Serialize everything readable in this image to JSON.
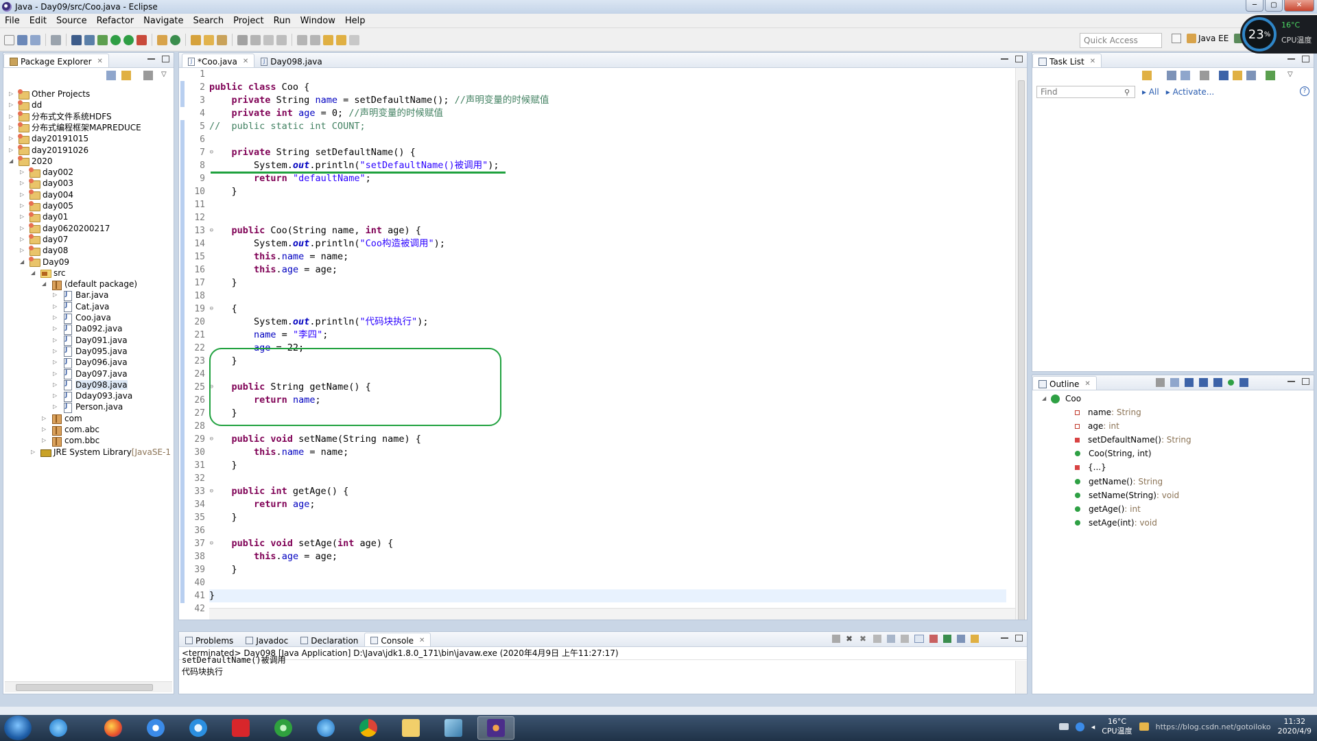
{
  "window": {
    "title": "Java - Day09/src/Coo.java - Eclipse",
    "buttons": [
      "─",
      "▢",
      "✕"
    ]
  },
  "menu": [
    "File",
    "Edit",
    "Source",
    "Refactor",
    "Navigate",
    "Search",
    "Project",
    "Run",
    "Window",
    "Help"
  ],
  "toolbar": {
    "quick_access_placeholder": "Quick Access",
    "perspective": "Java EE"
  },
  "cpu_widget": {
    "percent": "23",
    "percent_sign": "%",
    "temp": "16°C",
    "label": "CPU温度"
  },
  "package_explorer": {
    "title": "Package Explorer",
    "items": [
      {
        "label": "Other Projects",
        "icon": "project-icon",
        "depth": 0,
        "expand": "▷"
      },
      {
        "label": "dd",
        "icon": "project-icon",
        "depth": 0,
        "expand": "▷"
      },
      {
        "label": "分布式文件系统HDFS",
        "icon": "project-icon",
        "depth": 0,
        "expand": "▷"
      },
      {
        "label": "分布式编程框架MAPREDUCE",
        "icon": "project-icon",
        "depth": 0,
        "expand": "▷"
      },
      {
        "label": "day20191015",
        "icon": "project-icon",
        "depth": 0,
        "expand": "▷"
      },
      {
        "label": "day20191026",
        "icon": "project-icon",
        "depth": 0,
        "expand": "▷"
      },
      {
        "label": "2020",
        "icon": "project-icon",
        "depth": 0,
        "expand": "◢"
      },
      {
        "label": "day002",
        "icon": "project-icon",
        "depth": 1,
        "expand": "▷"
      },
      {
        "label": "day003",
        "icon": "project-icon",
        "depth": 1,
        "expand": "▷"
      },
      {
        "label": "day004",
        "icon": "project-icon",
        "depth": 1,
        "expand": "▷"
      },
      {
        "label": "day005",
        "icon": "project-icon",
        "depth": 1,
        "expand": "▷"
      },
      {
        "label": "day01",
        "icon": "project-icon",
        "depth": 1,
        "expand": "▷"
      },
      {
        "label": "day0620200217",
        "icon": "project-icon",
        "depth": 1,
        "expand": "▷"
      },
      {
        "label": "day07",
        "icon": "project-icon",
        "depth": 1,
        "expand": "▷"
      },
      {
        "label": "day08",
        "icon": "project-icon",
        "depth": 1,
        "expand": "▷"
      },
      {
        "label": "Day09",
        "icon": "project-icon",
        "depth": 1,
        "expand": "◢"
      },
      {
        "label": "src",
        "icon": "source-folder-icon",
        "depth": 2,
        "expand": "◢"
      },
      {
        "label": "(default package)",
        "icon": "package-icon",
        "depth": 3,
        "expand": "◢"
      },
      {
        "label": "Bar.java",
        "icon": "java-file-icon",
        "depth": 4,
        "expand": "▷"
      },
      {
        "label": "Cat.java",
        "icon": "java-file-icon",
        "depth": 4,
        "expand": "▷"
      },
      {
        "label": "Coo.java",
        "icon": "java-file-icon",
        "depth": 4,
        "expand": "▷"
      },
      {
        "label": "Da092.java",
        "icon": "java-file-icon",
        "depth": 4,
        "expand": "▷"
      },
      {
        "label": "Day091.java",
        "icon": "java-file-icon",
        "depth": 4,
        "expand": "▷"
      },
      {
        "label": "Day095.java",
        "icon": "java-file-icon",
        "depth": 4,
        "expand": "▷"
      },
      {
        "label": "Day096.java",
        "icon": "java-file-icon",
        "depth": 4,
        "expand": "▷"
      },
      {
        "label": "Day097.java",
        "icon": "java-file-icon",
        "depth": 4,
        "expand": "▷"
      },
      {
        "label": "Day098.java",
        "icon": "java-file-icon",
        "depth": 4,
        "expand": "▷",
        "selected": true
      },
      {
        "label": "Dday093.java",
        "icon": "java-file-icon",
        "depth": 4,
        "expand": "▷"
      },
      {
        "label": "Person.java",
        "icon": "java-file-icon",
        "depth": 4,
        "expand": "▷"
      },
      {
        "label": "com",
        "icon": "package-icon",
        "depth": 3,
        "expand": "▷"
      },
      {
        "label": "com.abc",
        "icon": "package-icon",
        "depth": 3,
        "expand": "▷"
      },
      {
        "label": "com.bbc",
        "icon": "package-icon",
        "depth": 3,
        "expand": "▷"
      },
      {
        "label": "JRE System Library",
        "suffix": " [JavaSE-1",
        "icon": "library-icon",
        "depth": 2,
        "expand": "▷"
      }
    ]
  },
  "editor": {
    "tabs": [
      {
        "label": "*Coo.java",
        "active": true
      },
      {
        "label": "Day098.java",
        "active": false
      }
    ],
    "lines": [
      {
        "n": "1",
        "tokens": []
      },
      {
        "n": "2",
        "tokens": [
          [
            "kw",
            "public class "
          ],
          [
            "",
            "Coo {"
          ]
        ]
      },
      {
        "n": "3",
        "tokens": [
          [
            "",
            "    "
          ],
          [
            "kw",
            "private "
          ],
          [
            "",
            "String "
          ],
          [
            "fld",
            "name"
          ],
          [
            "",
            " = setDefaultName(); "
          ],
          [
            "cmt",
            "//声明变量的时候赋值"
          ]
        ]
      },
      {
        "n": "4",
        "tokens": [
          [
            "",
            "    "
          ],
          [
            "kw",
            "private int "
          ],
          [
            "fld",
            "age"
          ],
          [
            "",
            " = 0; "
          ],
          [
            "cmt",
            "//声明变量的时候赋值"
          ]
        ]
      },
      {
        "n": "5",
        "tokens": [
          [
            "cmt",
            "//  public static int COUNT;"
          ]
        ]
      },
      {
        "n": "6",
        "tokens": []
      },
      {
        "n": "7",
        "fold": true,
        "tokens": [
          [
            "",
            "    "
          ],
          [
            "kw",
            "private "
          ],
          [
            "",
            "String setDefaultName() {"
          ]
        ]
      },
      {
        "n": "8",
        "tokens": [
          [
            "",
            "        System."
          ],
          [
            "sta",
            "out"
          ],
          [
            "",
            ".println("
          ],
          [
            "str",
            "\"setDefaultName()被调用\""
          ],
          [
            "",
            ");"
          ]
        ]
      },
      {
        "n": "9",
        "tokens": [
          [
            "",
            "        "
          ],
          [
            "kw",
            "return "
          ],
          [
            "str",
            "\"defaultName\""
          ],
          [
            "",
            ";"
          ]
        ]
      },
      {
        "n": "10",
        "tokens": [
          [
            "",
            "    }"
          ]
        ]
      },
      {
        "n": "11",
        "tokens": []
      },
      {
        "n": "12",
        "tokens": []
      },
      {
        "n": "13",
        "fold": true,
        "tokens": [
          [
            "",
            "    "
          ],
          [
            "kw",
            "public "
          ],
          [
            "",
            "Coo(String name, "
          ],
          [
            "kw",
            "int "
          ],
          [
            "",
            "age) {"
          ]
        ]
      },
      {
        "n": "14",
        "tokens": [
          [
            "",
            "        System."
          ],
          [
            "sta",
            "out"
          ],
          [
            "",
            ".println("
          ],
          [
            "str",
            "\"Coo构造被调用\""
          ],
          [
            "",
            ");"
          ]
        ]
      },
      {
        "n": "15",
        "tokens": [
          [
            "",
            "        "
          ],
          [
            "kw",
            "this"
          ],
          [
            "",
            "."
          ],
          [
            "fld",
            "name"
          ],
          [
            "",
            " = name;"
          ]
        ]
      },
      {
        "n": "16",
        "tokens": [
          [
            "",
            "        "
          ],
          [
            "kw",
            "this"
          ],
          [
            "",
            "."
          ],
          [
            "fld",
            "age"
          ],
          [
            "",
            " = age;"
          ]
        ]
      },
      {
        "n": "17",
        "tokens": [
          [
            "",
            "    }"
          ]
        ]
      },
      {
        "n": "18",
        "tokens": []
      },
      {
        "n": "19",
        "fold": true,
        "tokens": [
          [
            "",
            "    {"
          ]
        ]
      },
      {
        "n": "20",
        "tokens": [
          [
            "",
            "        System."
          ],
          [
            "sta",
            "out"
          ],
          [
            "",
            ".println("
          ],
          [
            "str",
            "\"代码块执行\""
          ],
          [
            "",
            ");"
          ]
        ]
      },
      {
        "n": "21",
        "tokens": [
          [
            "",
            "        "
          ],
          [
            "fld",
            "name"
          ],
          [
            "",
            " = "
          ],
          [
            "str",
            "\"李四\""
          ],
          [
            "",
            ";"
          ]
        ]
      },
      {
        "n": "22",
        "tokens": [
          [
            "",
            "        "
          ],
          [
            "fld",
            "age"
          ],
          [
            "",
            " = 22;"
          ]
        ]
      },
      {
        "n": "23",
        "tokens": [
          [
            "",
            "    }"
          ]
        ]
      },
      {
        "n": "24",
        "tokens": []
      },
      {
        "n": "25",
        "fold": true,
        "tokens": [
          [
            "",
            "    "
          ],
          [
            "kw",
            "public "
          ],
          [
            "",
            "String getName() {"
          ]
        ]
      },
      {
        "n": "26",
        "tokens": [
          [
            "",
            "        "
          ],
          [
            "kw",
            "return "
          ],
          [
            "fld",
            "name"
          ],
          [
            "",
            ";"
          ]
        ]
      },
      {
        "n": "27",
        "tokens": [
          [
            "",
            "    }"
          ]
        ]
      },
      {
        "n": "28",
        "tokens": []
      },
      {
        "n": "29",
        "fold": true,
        "tokens": [
          [
            "",
            "    "
          ],
          [
            "kw",
            "public void "
          ],
          [
            "",
            "setName(String name) {"
          ]
        ]
      },
      {
        "n": "30",
        "tokens": [
          [
            "",
            "        "
          ],
          [
            "kw",
            "this"
          ],
          [
            "",
            "."
          ],
          [
            "fld",
            "name"
          ],
          [
            "",
            " = name;"
          ]
        ]
      },
      {
        "n": "31",
        "tokens": [
          [
            "",
            "    }"
          ]
        ]
      },
      {
        "n": "32",
        "tokens": []
      },
      {
        "n": "33",
        "fold": true,
        "tokens": [
          [
            "",
            "    "
          ],
          [
            "kw",
            "public int "
          ],
          [
            "",
            "getAge() {"
          ]
        ]
      },
      {
        "n": "34",
        "tokens": [
          [
            "",
            "        "
          ],
          [
            "kw",
            "return "
          ],
          [
            "fld",
            "age"
          ],
          [
            "",
            ";"
          ]
        ]
      },
      {
        "n": "35",
        "tokens": [
          [
            "",
            "    }"
          ]
        ]
      },
      {
        "n": "36",
        "tokens": []
      },
      {
        "n": "37",
        "fold": true,
        "tokens": [
          [
            "",
            "    "
          ],
          [
            "kw",
            "public void "
          ],
          [
            "",
            "setAge("
          ],
          [
            "kw",
            "int "
          ],
          [
            "",
            "age) {"
          ]
        ]
      },
      {
        "n": "38",
        "tokens": [
          [
            "",
            "        "
          ],
          [
            "kw",
            "this"
          ],
          [
            "",
            "."
          ],
          [
            "fld",
            "age"
          ],
          [
            "",
            " = age;"
          ]
        ]
      },
      {
        "n": "39",
        "tokens": [
          [
            "",
            "    }"
          ]
        ]
      },
      {
        "n": "40",
        "tokens": []
      },
      {
        "n": "41",
        "current": true,
        "tokens": [
          [
            "",
            "}"
          ]
        ]
      },
      {
        "n": "42",
        "tokens": []
      }
    ]
  },
  "task_list": {
    "title": "Task List",
    "find_placeholder": "Find",
    "links": [
      "All",
      "Activate..."
    ]
  },
  "outline": {
    "title": "Outline",
    "class_name": "Coo",
    "members": [
      {
        "name": "name",
        "type": " : String",
        "kind": "private-field"
      },
      {
        "name": "age",
        "type": " : int",
        "kind": "private-field"
      },
      {
        "name": "setDefaultName()",
        "type": " : String",
        "kind": "private-method"
      },
      {
        "name": "Coo(String, int)",
        "type": "",
        "kind": "constructor"
      },
      {
        "name": "{...}",
        "type": "",
        "kind": "private-method"
      },
      {
        "name": "getName()",
        "type": " : String",
        "kind": "public-method"
      },
      {
        "name": "setName(String)",
        "type": " : void",
        "kind": "public-method"
      },
      {
        "name": "getAge()",
        "type": " : int",
        "kind": "public-method"
      },
      {
        "name": "setAge(int)",
        "type": " : void",
        "kind": "public-method"
      }
    ]
  },
  "bottom_panel": {
    "tabs": [
      {
        "label": "Problems",
        "active": false
      },
      {
        "label": "Javadoc",
        "active": false
      },
      {
        "label": "Declaration",
        "active": false
      },
      {
        "label": "Console",
        "active": true
      }
    ],
    "console_header": "<terminated> Day098 [Java Application] D:\\Java\\jdk1.8.0_171\\bin\\javaw.exe (2020年4月9日 上午11:27:17)",
    "console_lines": [
      "setDefaultName()被调用",
      "代码块执行"
    ]
  },
  "taskbar": {
    "tray_temp": "16°C",
    "tray_label": "CPU温度",
    "time": "11:32",
    "date": "2020/4/9",
    "watermark": "https://blog.csdn.net/gotoiloko"
  }
}
